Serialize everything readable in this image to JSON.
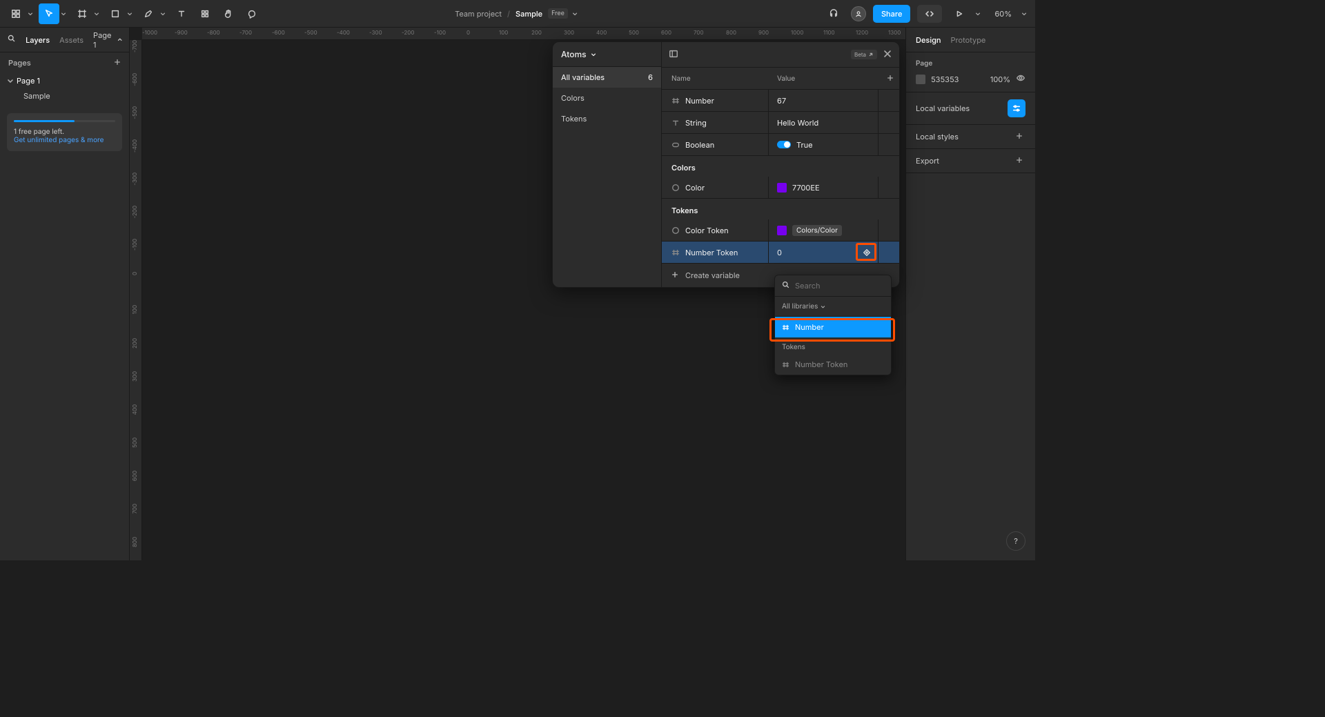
{
  "toolbar": {
    "team": "Team project",
    "file": "Sample",
    "badge": "Free",
    "share": "Share",
    "zoom": "60%"
  },
  "left": {
    "tab_layers": "Layers",
    "tab_assets": "Assets",
    "page_sel": "Page 1",
    "pages_hdr": "Pages",
    "pages": [
      "Page 1"
    ],
    "layers": [
      "Sample"
    ],
    "promo_line1": "1 free page left.",
    "promo_line2": "Get unlimited pages & more"
  },
  "right": {
    "tab_design": "Design",
    "tab_proto": "Prototype",
    "page_lbl": "Page",
    "bg_hex": "535353",
    "bg_pct": "100%",
    "locals_vars": "Local variables",
    "local_styles": "Local styles",
    "export": "Export"
  },
  "modal": {
    "collection": "Atoms",
    "beta": "Beta",
    "side_items": [
      {
        "label": "All variables",
        "count": "6"
      },
      {
        "label": "Colors"
      },
      {
        "label": "Tokens"
      }
    ],
    "col_name": "Name",
    "col_value": "Value",
    "groups": {
      "root": [
        {
          "type": "number",
          "name": "Number",
          "value": "67"
        },
        {
          "type": "string",
          "name": "String",
          "value": "Hello World"
        },
        {
          "type": "boolean",
          "name": "Boolean",
          "value": "True"
        }
      ],
      "colors_hdr": "Colors",
      "colors": [
        {
          "type": "color",
          "name": "Color",
          "value": "7700EE",
          "hex": "#7700ee"
        }
      ],
      "tokens_hdr": "Tokens",
      "tokens": [
        {
          "type": "color",
          "name": "Color Token",
          "alias": "Colors/Color",
          "hex": "#7700ee"
        },
        {
          "type": "number",
          "name": "Number Token",
          "value": "0"
        }
      ]
    },
    "create": "Create variable"
  },
  "picker": {
    "placeholder": "Search",
    "libraries": "All libraries",
    "opt_number": "Number",
    "grp_tokens": "Tokens",
    "opt_number_token": "Number Token"
  },
  "ruler_h": [
    "-1000",
    "-900",
    "-800",
    "-700",
    "-600",
    "-500",
    "-400",
    "-300",
    "-200",
    "-100",
    "0",
    "100",
    "200",
    "300",
    "400",
    "500",
    "600",
    "700",
    "800",
    "900",
    "1000",
    "1100",
    "1200",
    "1300"
  ],
  "ruler_v": [
    "-700",
    "-600",
    "-500",
    "-400",
    "-300",
    "-200",
    "-100",
    "0",
    "100",
    "200",
    "300",
    "400",
    "500",
    "600",
    "700",
    "800"
  ],
  "help": "?"
}
